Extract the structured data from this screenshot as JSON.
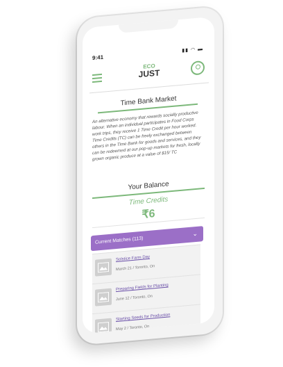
{
  "status": {
    "time": "9:41"
  },
  "logo": {
    "line1": "ECO",
    "line2": "JUST"
  },
  "market": {
    "title": "Time Bank Market",
    "description": "An alternative economy that rewards socially productive labour. When an individual participates in Food Corps work trips, they receive 1 Time Credit per hour worked. Time Credits (TC) can be freely exchanged between others in the Time Bank for goods and services, and they can be redeemed at our pop-up markets for fresh, locally grown organic produce at a value of $15/ TC"
  },
  "balance": {
    "title": "Your Balance",
    "credits_label": "Time Credits",
    "credits_value": "₹6"
  },
  "matches": {
    "label": "Current Matches (113)",
    "items": [
      {
        "title": "Solstice Farm Day",
        "meta": "March 21 / Toronto, On"
      },
      {
        "title": "Preparing Fields for Planting",
        "meta": "June 12 / Toronto, On"
      },
      {
        "title": "Starting Seeds for Production",
        "meta": "May 2 / Toronto, On"
      }
    ]
  },
  "colors": {
    "accent_green": "#7cb87a",
    "accent_purple": "#9b6fc7"
  }
}
